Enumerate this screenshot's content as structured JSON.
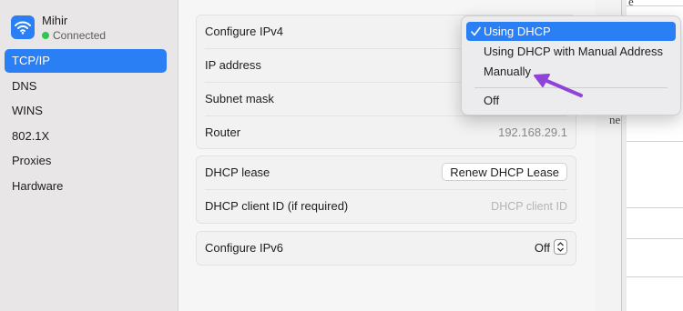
{
  "network": {
    "name": "Mihir",
    "status": "Connected",
    "icon": "wifi-icon",
    "status_color": "#31c552"
  },
  "sidebar": {
    "items": [
      {
        "label": "TCP/IP",
        "active": true
      },
      {
        "label": "DNS"
      },
      {
        "label": "WINS"
      },
      {
        "label": "802.1X"
      },
      {
        "label": "Proxies"
      },
      {
        "label": "Hardware"
      }
    ]
  },
  "ipv4": {
    "configure_label": "Configure IPv4",
    "ip_label": "IP address",
    "subnet_label": "Subnet mask",
    "router_label": "Router",
    "router_value": "192.168.29.1"
  },
  "dhcp": {
    "lease_label": "DHCP lease",
    "renew_button": "Renew DHCP Lease",
    "client_id_label": "DHCP client ID (if required)",
    "client_id_placeholder": "DHCP client ID"
  },
  "ipv6": {
    "configure_label": "Configure IPv6",
    "value": "Off"
  },
  "menu": {
    "items": [
      {
        "label": "Using DHCP",
        "checked": true,
        "selected": true
      },
      {
        "label": "Using DHCP with Manual Address"
      },
      {
        "label": "Manually"
      },
      {
        "label": "Off"
      }
    ]
  },
  "background_fragment": {
    "text1": "e",
    "text2": "ne"
  },
  "colors": {
    "accent": "#2a7ff5",
    "pointer": "#8e44d8"
  }
}
